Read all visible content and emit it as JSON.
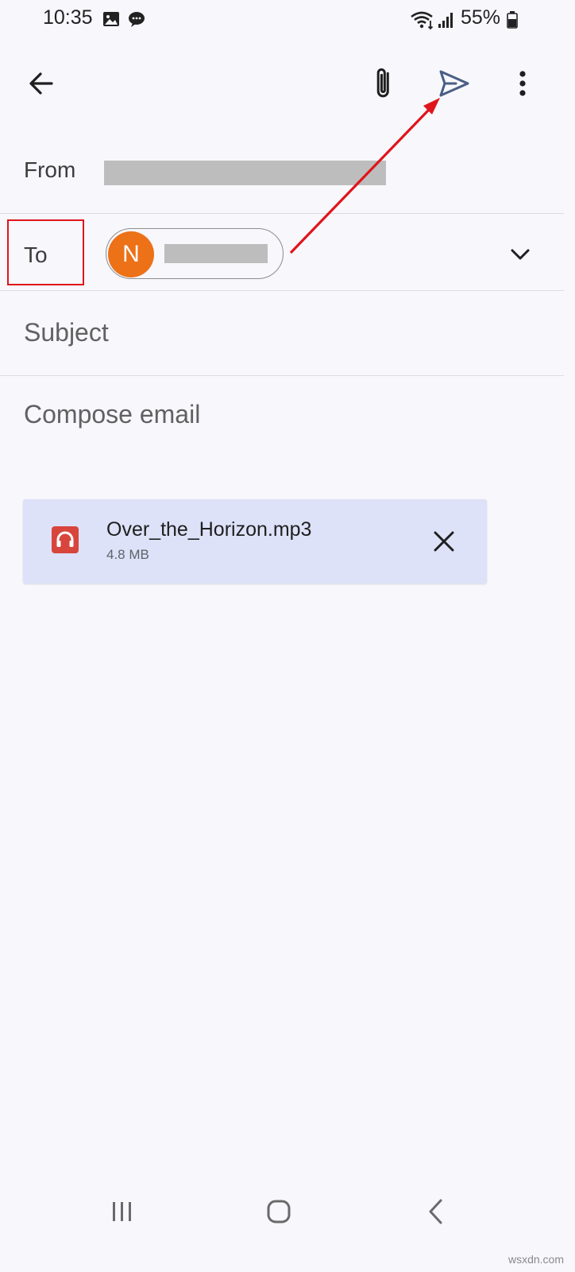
{
  "status_bar": {
    "time": "10:35",
    "battery": "55%",
    "icons": [
      "gallery-icon",
      "chat-bubble-icon",
      "wifi-icon",
      "signal-icon",
      "battery-icon"
    ]
  },
  "toolbar": {
    "back_icon": "arrow-left-icon",
    "attach_icon": "paperclip-icon",
    "send_icon": "send-icon",
    "more_icon": "more-vert-icon"
  },
  "compose": {
    "from_label": "From",
    "to_label": "To",
    "recipient_initial": "N",
    "subject_placeholder": "Subject",
    "body_placeholder": "Compose email"
  },
  "attachment": {
    "file_name": "Over_the_Horizon.mp3",
    "file_size": "4.8 MB",
    "file_icon": "headphones-icon",
    "remove_icon": "close-icon"
  },
  "watermark": "wsxdn.com",
  "colors": {
    "annotation_red": "#e0141b",
    "avatar_orange": "#ec7117",
    "send_blue": "#4a5e84",
    "attachment_bg": "#dde2f8",
    "audio_icon_red": "#d8453d"
  }
}
